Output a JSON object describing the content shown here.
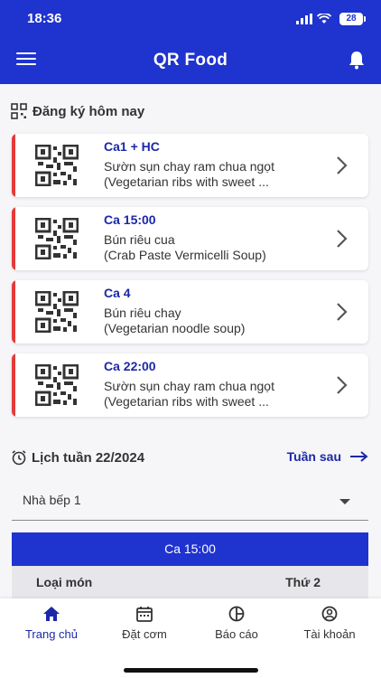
{
  "status_bar": {
    "time": "18:36",
    "battery": "28"
  },
  "header": {
    "title": "QR Food"
  },
  "today": {
    "title": "Đăng ký hôm nay",
    "items": [
      {
        "shift": "Ca1 + HC",
        "dish_vi": "Sườn sụn chay ram chua ngọt",
        "dish_en": "(Vegetarian ribs with sweet ..."
      },
      {
        "shift": "Ca 15:00",
        "dish_vi": "Bún riêu cua",
        "dish_en": "(Crab Paste Vermicelli Soup)"
      },
      {
        "shift": "Ca 4",
        "dish_vi": "Bún riêu chay",
        "dish_en": "(Vegetarian noodle soup)"
      },
      {
        "shift": "Ca 22:00",
        "dish_vi": "Sườn sụn chay ram chua ngọt",
        "dish_en": "(Vegetarian ribs with sweet ..."
      }
    ]
  },
  "weekly": {
    "title": "Lịch tuần 22/2024",
    "next_label": "Tuần sau",
    "kitchen": "Nhà bếp 1",
    "shift_tab": "Ca 15:00",
    "table_headers": [
      "Loại món",
      "Thứ 2"
    ]
  },
  "bottom_nav": [
    {
      "label": "Trang chủ",
      "icon": "home-icon",
      "active": true
    },
    {
      "label": "Đặt cơm",
      "icon": "calendar-icon",
      "active": false
    },
    {
      "label": "Báo cáo",
      "icon": "report-icon",
      "active": false
    },
    {
      "label": "Tài khoản",
      "icon": "account-icon",
      "active": false
    }
  ],
  "colors": {
    "primary": "#1f33cf",
    "accent_text": "#1c28a8",
    "card_bar": "#e53a3a"
  }
}
